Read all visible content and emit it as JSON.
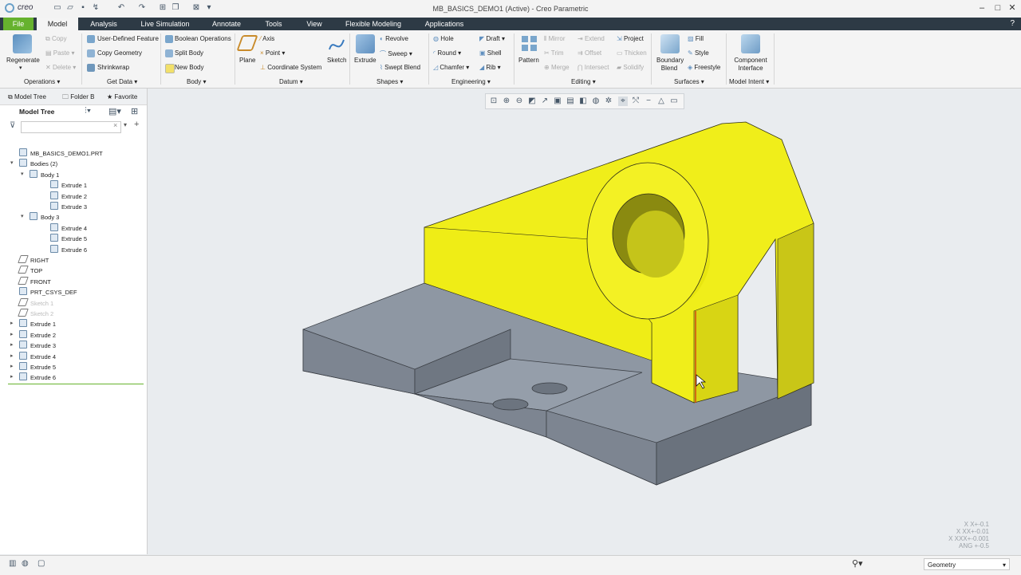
{
  "window": {
    "title": "MB_BASICS_DEMO1 (Active) - Creo Parametric",
    "logo": "creo"
  },
  "menu": {
    "tabs": [
      "File",
      "Model",
      "Analysis",
      "Live Simulation",
      "Annotate",
      "Tools",
      "View",
      "Flexible Modeling",
      "Applications"
    ],
    "active": "Model"
  },
  "ribbon": {
    "operations": {
      "regenerate": "Regenerate",
      "copy": "Copy",
      "paste": "Paste",
      "delete": "Delete",
      "label": "Operations"
    },
    "get_data": {
      "udf": "User-Defined Feature",
      "copy_geometry": "Copy Geometry",
      "shrinkwrap": "Shrinkwrap",
      "label": "Get Data"
    },
    "body": {
      "boolean": "Boolean Operations",
      "split": "Split Body",
      "new": "New Body",
      "label": "Body"
    },
    "datum": {
      "plane": "Plane",
      "axis": "Axis",
      "point": "Point",
      "csys": "Coordinate System",
      "sketch": "Sketch",
      "label": "Datum"
    },
    "shapes": {
      "extrude": "Extrude",
      "revolve": "Revolve",
      "sweep": "Sweep",
      "swept_blend": "Swept Blend",
      "label": "Shapes"
    },
    "engineering": {
      "hole": "Hole",
      "round": "Round",
      "chamfer": "Chamfer",
      "draft": "Draft",
      "shell": "Shell",
      "rib": "Rib",
      "label": "Engineering"
    },
    "editing": {
      "pattern": "Pattern",
      "mirror": "Mirror",
      "trim": "Trim",
      "merge": "Merge",
      "extend": "Extend",
      "offset": "Offset",
      "intersect": "Intersect",
      "project": "Project",
      "thicken": "Thicken",
      "solidify": "Solidify",
      "label": "Editing"
    },
    "surfaces": {
      "boundary_blend": "Boundary Blend",
      "fill": "Fill",
      "style": "Style",
      "freestyle": "Freestyle",
      "label": "Surfaces"
    },
    "model_intent": {
      "component_interface": "Component Interface",
      "label": "Model Intent"
    }
  },
  "left_panel": {
    "tabs": [
      "Model Tree",
      "Folder B",
      "Favorite"
    ],
    "header": "Model Tree",
    "tree": [
      {
        "label": "MB_BASICS_DEMO1.PRT"
      },
      {
        "label": "Bodies (2)"
      },
      {
        "label": "Body 1"
      },
      {
        "label": "Extrude 1"
      },
      {
        "label": "Extrude 2"
      },
      {
        "label": "Extrude 3"
      },
      {
        "label": "Body 3"
      },
      {
        "label": "Extrude 4"
      },
      {
        "label": "Extrude 5"
      },
      {
        "label": "Extrude 6"
      },
      {
        "label": "RIGHT"
      },
      {
        "label": "TOP"
      },
      {
        "label": "FRONT"
      },
      {
        "label": "PRT_CSYS_DEF"
      },
      {
        "label": "Sketch 1"
      },
      {
        "label": "Sketch 2"
      },
      {
        "label": "Extrude 1"
      },
      {
        "label": "Extrude 2"
      },
      {
        "label": "Extrude 3"
      },
      {
        "label": "Extrude 4"
      },
      {
        "label": "Extrude 5"
      },
      {
        "label": "Extrude 6"
      }
    ]
  },
  "status": {
    "filter": "Geometry",
    "tolerances": [
      "X X+-0.1",
      "X XX+-0.01",
      "X XXX+-0.001",
      "ANG +-0.5"
    ]
  },
  "colors": {
    "menubar": "#2d3a45",
    "file_tab": "#66b22e",
    "yellow_body": "#f0ee1a",
    "gray_body": "#8e97a3"
  }
}
